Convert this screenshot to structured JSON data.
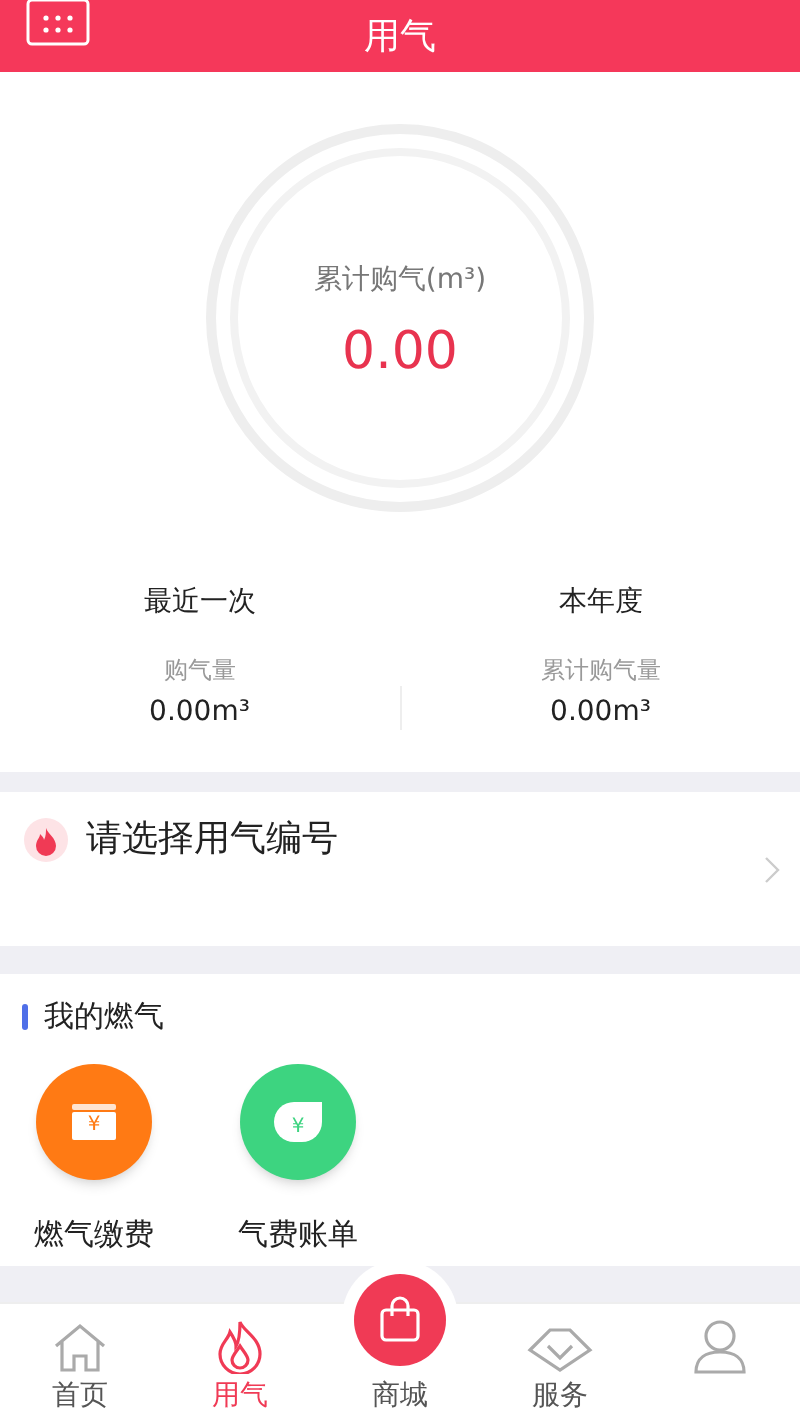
{
  "header": {
    "title": "用气"
  },
  "summary": {
    "label": "累计购气(m³)",
    "value": "0.00"
  },
  "stats": [
    {
      "heading": "最近一次",
      "label": "购气量",
      "value": "0.00m³"
    },
    {
      "heading": "本年度",
      "label": "累计购气量",
      "value": "0.00m³"
    }
  ],
  "account_select": {
    "label": "请选择用气编号"
  },
  "my_gas": {
    "title": "我的燃气",
    "services": [
      {
        "kind": "pay",
        "symbol": "¥",
        "label": "燃气缴费"
      },
      {
        "kind": "bill",
        "symbol": "¥",
        "label": "气费账单"
      }
    ]
  },
  "tab_bar": [
    {
      "kind": "home",
      "label": "首页",
      "selected": false
    },
    {
      "kind": "gas",
      "label": "用气",
      "selected": true
    },
    {
      "kind": "mall",
      "label": "商城",
      "selected": false
    },
    {
      "kind": "service",
      "label": "服务",
      "selected": false
    },
    {
      "kind": "profile",
      "selected": false
    }
  ]
}
